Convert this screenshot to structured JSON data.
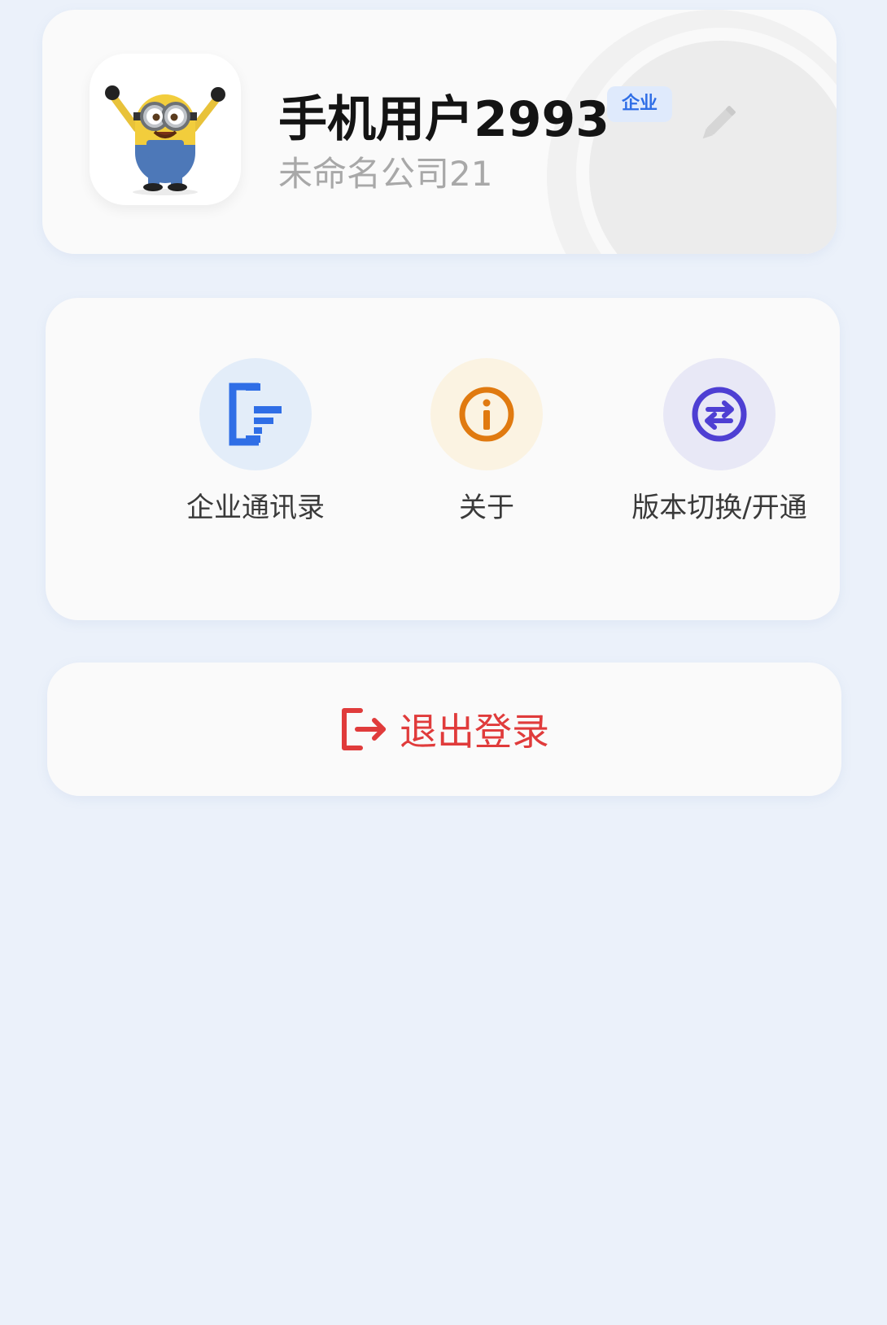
{
  "profile": {
    "user_name": "手机用户2993",
    "badge": "企业",
    "company": "未命名公司21"
  },
  "menu": {
    "items": [
      {
        "label": "企业通讯录",
        "icon": "contacts-icon",
        "color": "#2f6ee6",
        "bg": "#e3edf9"
      },
      {
        "label": "关于",
        "icon": "info-icon",
        "color": "#e07a10",
        "bg": "#fbf3e2"
      },
      {
        "label": "版本切换/开通",
        "icon": "switch-icon",
        "color": "#4e3fd3",
        "bg": "#e8e8f6"
      }
    ]
  },
  "logout": {
    "label": "退出登录",
    "color": "#e03b3b"
  },
  "colors": {
    "background": "#ebf1fa",
    "card": "#fafafa"
  }
}
